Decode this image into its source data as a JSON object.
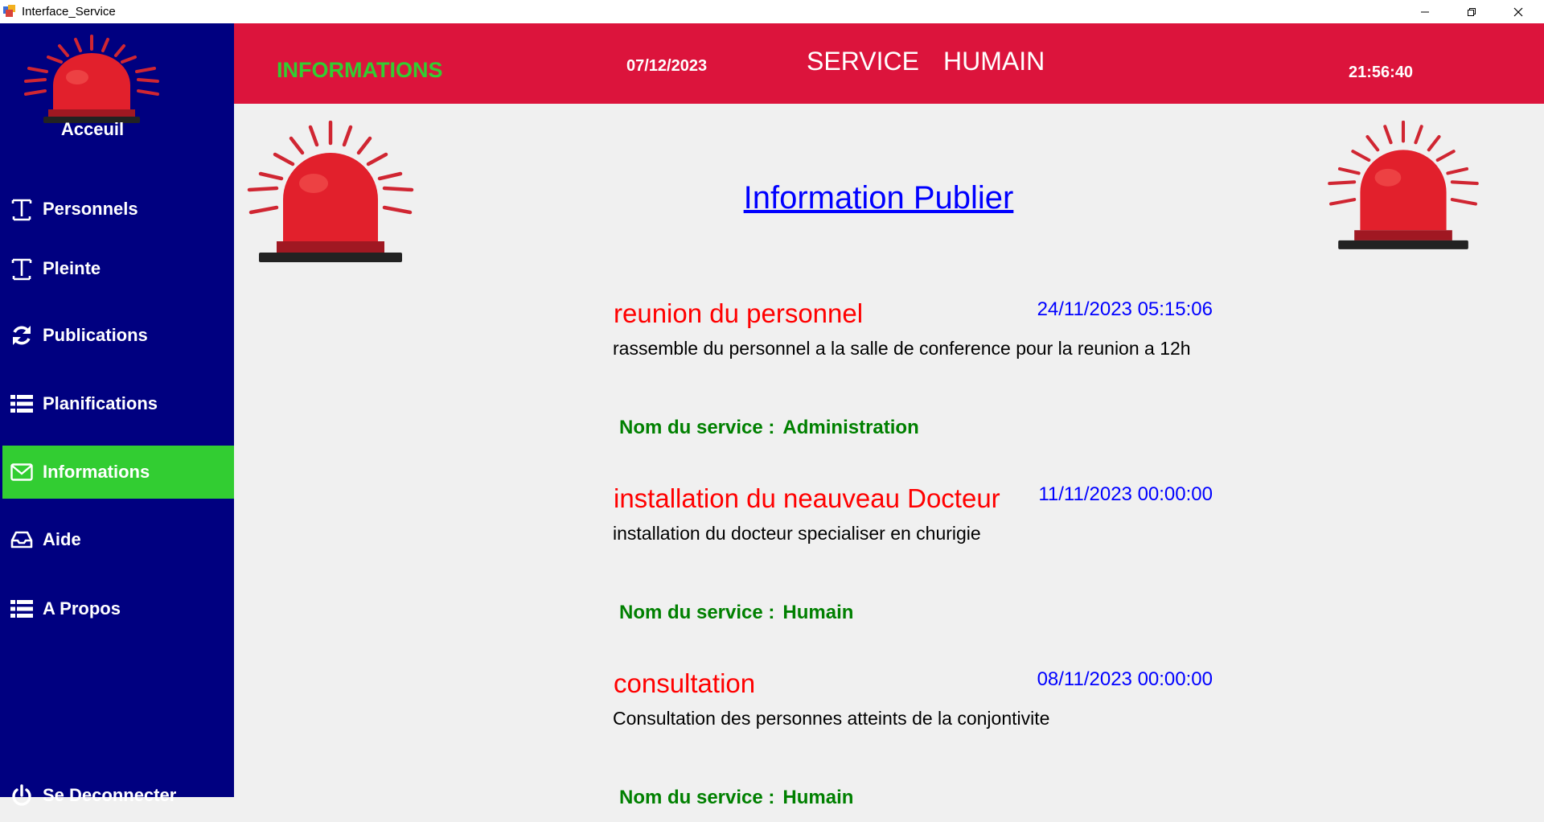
{
  "window": {
    "title": "Interface_Service",
    "controls": {
      "minimize": "–",
      "restore": "❐",
      "close": "✕"
    }
  },
  "sidebar": {
    "home_label": "Acceuil",
    "items": [
      {
        "label": "Personnels",
        "icon": "text-cursor-icon"
      },
      {
        "label": "Pleinte",
        "icon": "text-cursor-icon"
      },
      {
        "label": "Publications",
        "icon": "refresh-icon"
      },
      {
        "label": "Planifications",
        "icon": "list-icon"
      },
      {
        "label": "Informations",
        "icon": "envelope-icon",
        "active": true
      },
      {
        "label": "Aide",
        "icon": "inbox-icon"
      },
      {
        "label": "A Propos",
        "icon": "list-icon"
      }
    ],
    "logout_label": "Se Deconnecter"
  },
  "header": {
    "section": "INFORMATIONS",
    "date": "07/12/2023",
    "service_word": "SERVICE",
    "service_name": "HUMAIN",
    "time": "21:56:40"
  },
  "main": {
    "title": "Information Publier",
    "service_prefix": "Nom du service :",
    "posts": [
      {
        "title": "reunion  du personnel",
        "datetime": "24/11/2023 05:15:06",
        "body": "rassemble du personnel a la salle de conference pour la reunion a 12h",
        "service": "Administration"
      },
      {
        "title": "installation du neauveau Docteur",
        "datetime": "11/11/2023 00:00:00",
        "body": "installation du docteur specialiser en churigie",
        "service": "Humain"
      },
      {
        "title": "consultation",
        "datetime": "08/11/2023 00:00:00",
        "body": "Consultation des personnes atteints de la conjontivite",
        "service": "Humain"
      }
    ]
  },
  "colors": {
    "sidebar_bg": "#000080",
    "header_bg": "#dc143c",
    "active_item": "#32cd32",
    "post_title": "#ff0000",
    "post_date": "#0000ff",
    "service_text": "#008000"
  }
}
